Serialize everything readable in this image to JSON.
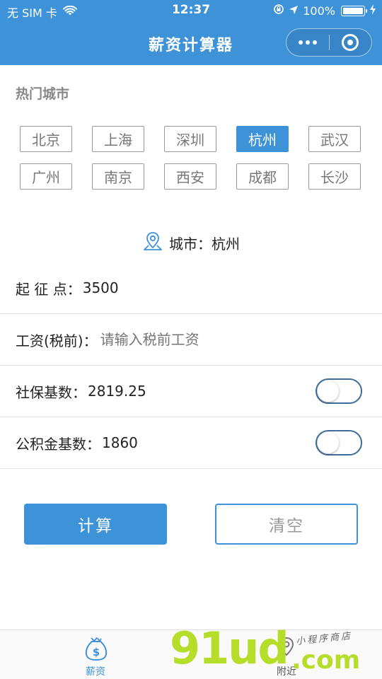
{
  "status_bar": {
    "carrier": "无 SIM 卡",
    "time": "12:37",
    "battery": "100%"
  },
  "nav": {
    "title": "薪资计算器"
  },
  "hot_cities": {
    "title": "热门城市",
    "cities": [
      "北京",
      "上海",
      "深圳",
      "杭州",
      "武汉",
      "广州",
      "南京",
      "西安",
      "成都",
      "长沙"
    ],
    "selected": "杭州"
  },
  "current_city": {
    "label": "城市：",
    "value": "杭州"
  },
  "form": {
    "threshold_label": "起 征 点：",
    "threshold_value": "3500",
    "salary_label": "工资(税前)：",
    "salary_placeholder": "请输入税前工资",
    "social_label": "社保基数：",
    "social_value": "2819.25",
    "social_toggle_on": false,
    "fund_label": "公积金基数：",
    "fund_value": "1860",
    "fund_toggle_on": false
  },
  "buttons": {
    "calculate": "计算",
    "clear": "清空"
  },
  "tabs": [
    {
      "label": "薪资",
      "active": true
    },
    {
      "label": "附近",
      "active": false
    }
  ],
  "watermark": {
    "main": "91ud",
    "suffix": ".com",
    "tagline": "小程序商店"
  },
  "colors": {
    "primary": "#3d92d8",
    "watermark": "#b5dd2a"
  }
}
